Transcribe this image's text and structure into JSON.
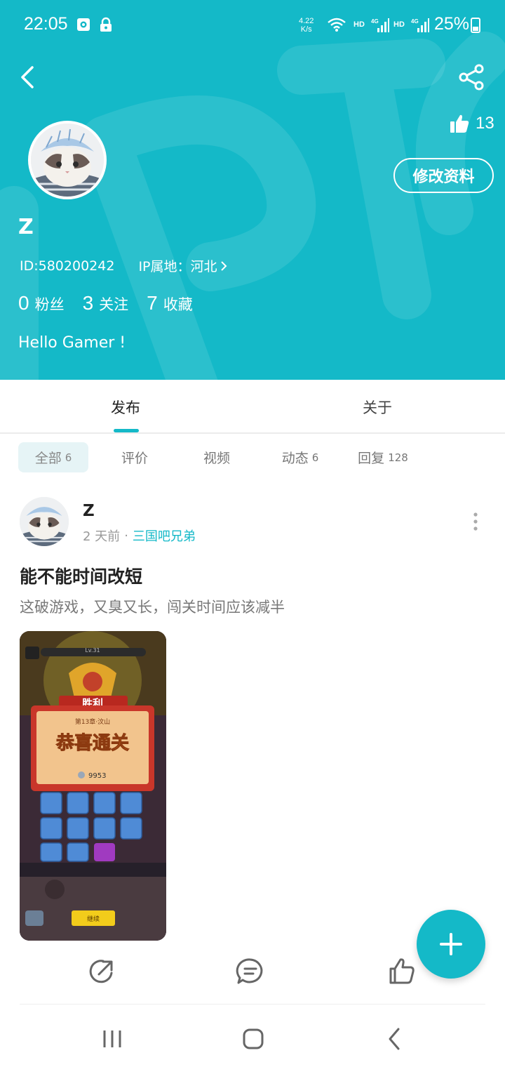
{
  "status_bar": {
    "time": "22:05",
    "net_speed_value": "4.22",
    "net_speed_unit": "K/s",
    "hd1": "HD",
    "hd2": "HD",
    "network1": "4G",
    "network2": "4G",
    "battery": "25%"
  },
  "header": {
    "likes_count": "13",
    "edit_profile_label": "修改资料",
    "username": "Z",
    "user_id": "ID:580200242",
    "ip_location": "IP属地：河北",
    "stats": [
      {
        "num": "0",
        "label": "粉丝"
      },
      {
        "num": "3",
        "label": "关注"
      },
      {
        "num": "7",
        "label": "收藏"
      }
    ],
    "bio": "Hello Gamer !"
  },
  "tabs": [
    {
      "label": "发布",
      "active": true
    },
    {
      "label": "关于",
      "active": false
    }
  ],
  "filters": [
    {
      "label": "全部",
      "count": "6",
      "active": true
    },
    {
      "label": "评价",
      "count": "",
      "active": false
    },
    {
      "label": "视频",
      "count": "",
      "active": false
    },
    {
      "label": "动态",
      "count": "6",
      "active": false
    },
    {
      "label": "回复",
      "count": "128",
      "active": false
    }
  ],
  "post": {
    "author": "Z",
    "time_ago": "2 天前",
    "separator": "·",
    "group": "三国吧兄弟",
    "title": "能不能时间改短",
    "body": "这破游戏，又臭又长，闯关时间应该减半",
    "image": {
      "level": "Lv.31",
      "banner": "胜利",
      "chapter": "第13章·汶山",
      "headline": "恭喜通关",
      "coins": "9953",
      "continue_label": "继续"
    }
  },
  "colors": {
    "brand_teal": "#14b9c8",
    "chip_bg": "#e6f4f6"
  },
  "icons": [
    "back-icon",
    "share-icon",
    "thumbs-up-icon",
    "chevron-right-icon",
    "more-vertical-icon",
    "share-arrow-icon",
    "comment-icon",
    "like-icon",
    "plus-icon",
    "recents-icon",
    "home-icon",
    "nav-back-icon"
  ]
}
